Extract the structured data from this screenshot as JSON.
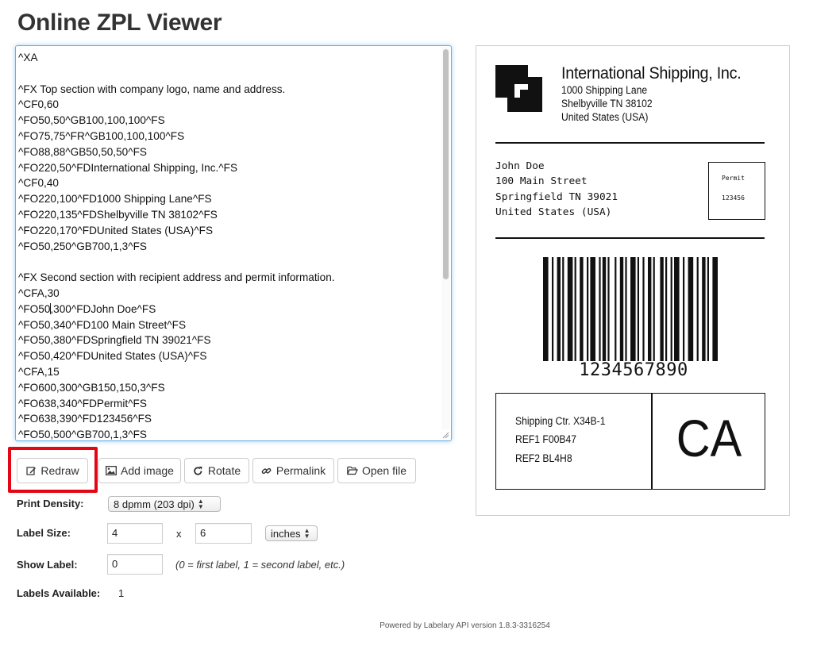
{
  "page": {
    "title": "Online ZPL Viewer"
  },
  "editor": {
    "lines": [
      "^XA",
      "",
      "^FX Top section with company logo, name and address.",
      "^CF0,60",
      "^FO50,50^GB100,100,100^FS",
      "^FO75,75^FR^GB100,100,100^FS",
      "^FO88,88^GB50,50,50^FS",
      "^FO220,50^FDInternational Shipping, Inc.^FS",
      "^CF0,40",
      "^FO220,100^FD1000 Shipping Lane^FS",
      "^FO220,135^FDShelbyville TN 38102^FS",
      "^FO220,170^FDUnited States (USA)^FS",
      "^FO50,250^GB700,1,3^FS",
      "",
      "^FX Second section with recipient address and permit information.",
      "^CFA,30",
      "^FO50,300^FDJohn Doe^FS",
      "^FO50,340^FD100 Main Street^FS",
      "^FO50,380^FDSpringfield TN 39021^FS",
      "^FO50,420^FDUnited States (USA)^FS",
      "^CFA,15",
      "^FO600,300^GB150,150,3^FS",
      "^FO638,340^FDPermit^FS",
      "^FO638,390^FD123456^FS",
      "^FO50,500^GB700,1,3^FS"
    ]
  },
  "buttons": {
    "redraw": "Redraw",
    "add_image": "Add image",
    "rotate": "Rotate",
    "permalink": "Permalink",
    "open_file": "Open file"
  },
  "settings": {
    "print_density_label": "Print Density:",
    "print_density_value": "8 dpmm (203 dpi)",
    "label_size_label": "Label Size:",
    "width": "4",
    "size_separator": "x",
    "height": "6",
    "unit": "inches",
    "show_label_label": "Show Label:",
    "show_label_value": "0",
    "show_label_hint": "(0 = first label, 1 = second label, etc.)",
    "labels_available_label": "Labels Available:",
    "labels_available_value": "1"
  },
  "footer": "Powered by Labelary API version 1.8.3-3316254",
  "label": {
    "company": "International Shipping, Inc.",
    "company_address": [
      "1000 Shipping Lane",
      "Shelbyville TN 38102",
      "United States (USA)"
    ],
    "recipient": [
      "John Doe",
      "100 Main Street",
      "Springfield TN 39021",
      "United States (USA)"
    ],
    "permit_title": "Permit",
    "permit_number": "123456",
    "barcode_value": "1234567890",
    "shipping_lines": [
      "Shipping Ctr. X34B-1",
      "REF1 F00B47",
      "REF2 BL4H8"
    ],
    "state": "CA"
  },
  "colors": {
    "highlight": "#e30613",
    "focus_border": "#66afe9"
  }
}
